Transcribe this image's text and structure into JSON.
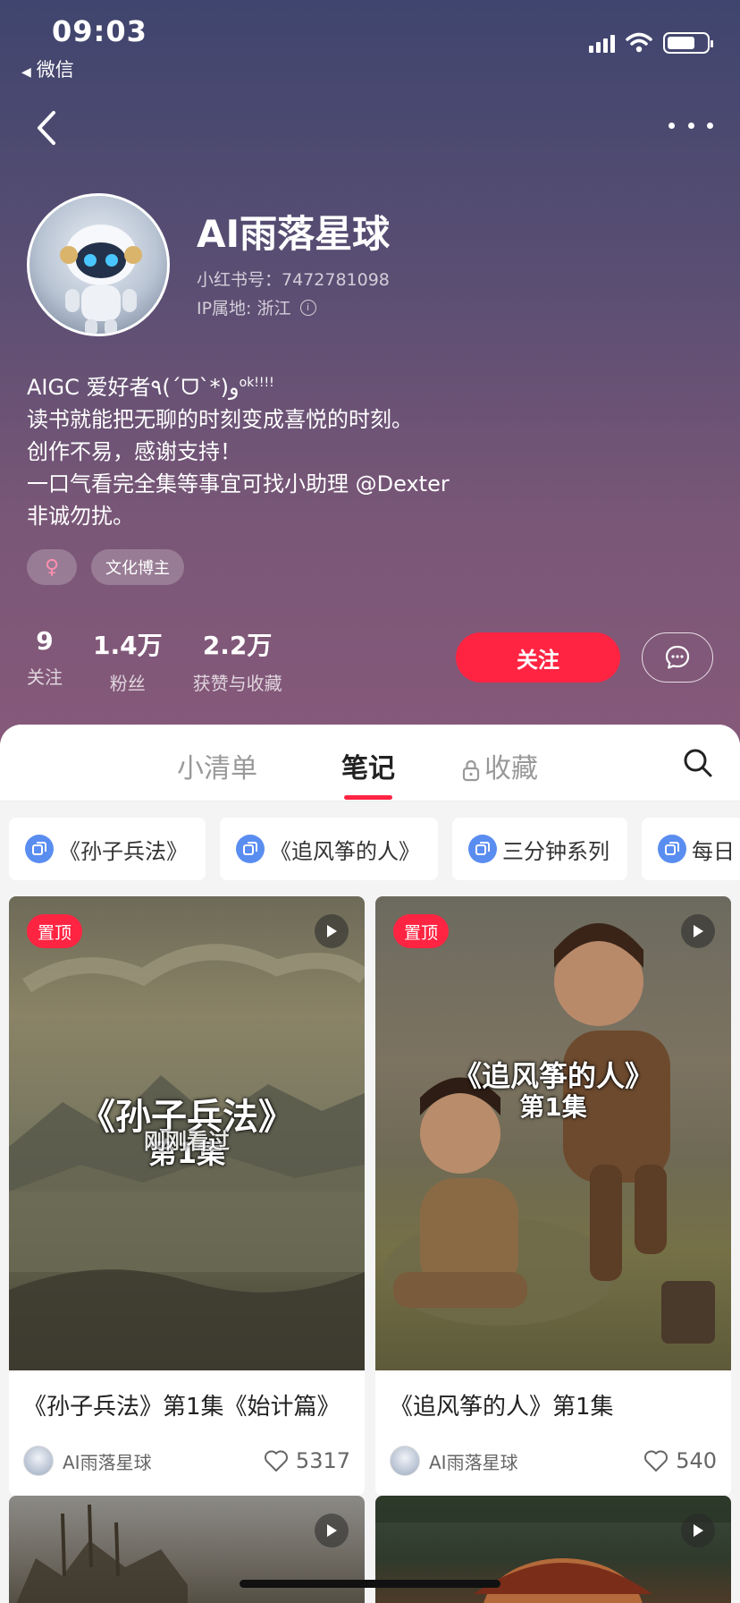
{
  "status_bar": {
    "time": "09:03",
    "back_app": "微信"
  },
  "profile": {
    "name": "AI雨落星球",
    "id_line": "小红书号：7472781098",
    "ip_line": "IP属地: 浙江",
    "bio": [
      "AIGC 爱好者٩(ˊᗜˋ*)و",
      "读书就能把无聊的时刻变成喜悦的时刻。",
      "创作不易，感谢支持！",
      "一口气看完全集等事宜可找小助理 ",
      "非诚勿扰。"
    ],
    "bio_sup": "ok!!!!",
    "bio_mention": "@Dexter",
    "tags": [
      "♀",
      "文化博主"
    ]
  },
  "stats": [
    {
      "value": "9",
      "label": "关注"
    },
    {
      "value": "1.4万",
      "label": "粉丝"
    },
    {
      "value": "2.2万",
      "label": "获赞与收藏"
    }
  ],
  "actions": {
    "follow": "关注"
  },
  "tabs": {
    "list": "小清单",
    "notes": "笔记",
    "collect": "收藏"
  },
  "chips": [
    "《孙子兵法》",
    "《追风筝的人》",
    "三分钟系列",
    "每日"
  ],
  "cards": [
    {
      "pin": "置顶",
      "overlay_line1": "《孙子兵法》",
      "overlay_line2": "第1集",
      "overlay_extra": "刚刚看过",
      "title": "《孙子兵法》第1集《始计篇》",
      "author": "AI雨落星球",
      "likes": "5317"
    },
    {
      "pin": "置顶",
      "overlay_line1": "《追风筝的人》",
      "overlay_line2": "第1集",
      "title": "《追风筝的人》第1集",
      "author": "AI雨落星球",
      "likes": "540"
    }
  ],
  "colors": {
    "accent": "#ff2442",
    "chip_icon": "#5a8df0"
  }
}
